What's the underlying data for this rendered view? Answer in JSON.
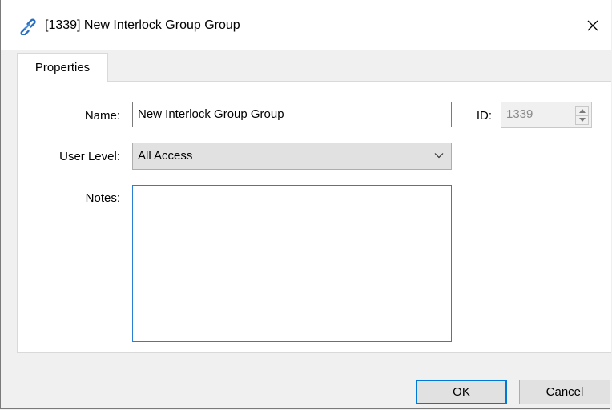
{
  "window": {
    "title": "[1339] New Interlock Group Group",
    "icon": "link-icon",
    "close_glyph": "✕"
  },
  "tabs": [
    {
      "label": "Properties",
      "selected": true
    }
  ],
  "form": {
    "name_label": "Name:",
    "name_value": "New Interlock Group Group",
    "id_label": "ID:",
    "id_value": "1339",
    "user_level_label": "User Level:",
    "user_level_value": "All Access",
    "notes_label": "Notes:",
    "notes_value": ""
  },
  "buttons": {
    "ok_label": "OK",
    "cancel_label": "Cancel"
  },
  "colors": {
    "accent": "#0078d7",
    "notes_border": "#2a7fd4"
  }
}
